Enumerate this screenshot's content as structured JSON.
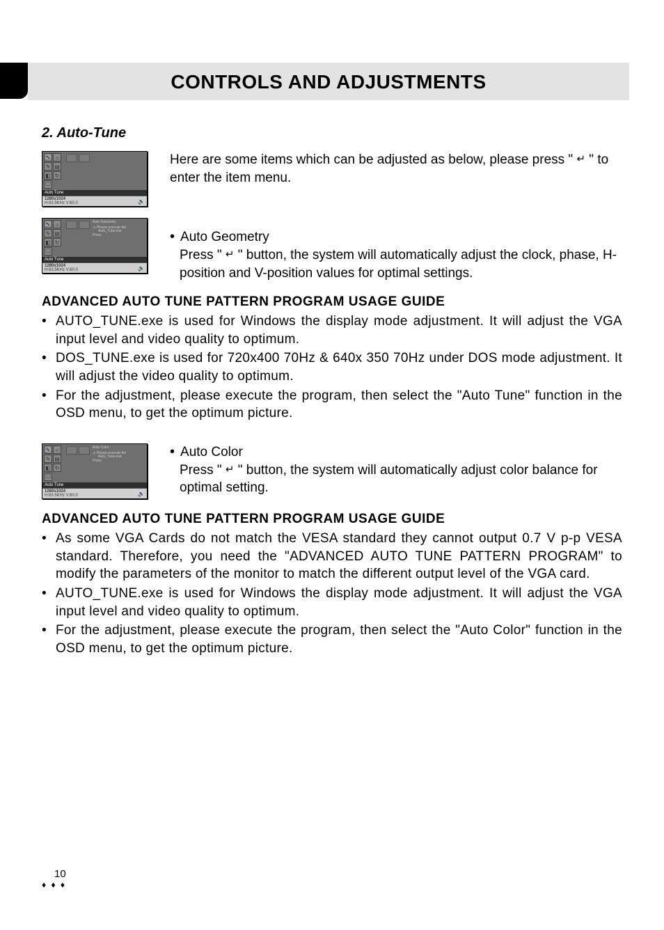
{
  "title": "CONTROLS AND ADJUSTMENTS",
  "section_number_title": "2. Auto-Tune",
  "intro_text_1": "Here are some items which can be adjusted as below, please press \" ",
  "intro_text_2": " \" to enter the item menu.",
  "enter_symbol": "↵",
  "osd_common": {
    "label": "Auto Tune",
    "res": "1280x1024",
    "freq": "H:63.5KHz V:60.0"
  },
  "osd2": {
    "sub_title": "Auto Geometry",
    "hint1": "Please execute the",
    "hint2": "Auto_Tune.exe",
    "hint3": "Press"
  },
  "osd3": {
    "sub_title": "Auto Color",
    "hint1": "Please execute the",
    "hint2": "Auto_Tune.exe",
    "hint3": "Press"
  },
  "auto_geometry": {
    "title": "Auto Geometry",
    "line1a": "Press \" ",
    "line1b": " \" button, the system will automatically adjust the clock, phase, H-position and V-position values for optimal settings."
  },
  "guide1": {
    "heading": "ADVANCED AUTO TUNE PATTERN PROGRAM USAGE GUIDE",
    "b1": "AUTO_TUNE.exe is used for Windows the display mode adjustment. It will adjust the VGA input level and video quality to optimum.",
    "b2": "DOS_TUNE.exe is used for 720x400 70Hz & 640x 350 70Hz under DOS mode adjustment. It will adjust the video quality to optimum.",
    "b3": "For the adjustment, please execute the program, then select the \"Auto Tune\" function in the OSD menu, to get the optimum picture."
  },
  "auto_color": {
    "title": "Auto Color",
    "line1a": "Press \" ",
    "line1b": " \" button, the system will automatically adjust color balance for optimal setting."
  },
  "guide2": {
    "heading": "ADVANCED AUTO TUNE PATTERN PROGRAM USAGE GUIDE",
    "b1": "As some VGA Cards do not match the VESA standard they cannot output 0.7 V p-p VESA standard. Therefore, you need the \"ADVANCED AUTO TUNE PATTERN PROGRAM\" to modify the parameters of the monitor to match the different output level of the VGA card.",
    "b2": "AUTO_TUNE.exe is used for Windows the display mode adjustment. It will adjust the VGA input level and video quality to optimum.",
    "b3": "For the adjustment, please execute the program, then select the \"Auto Color\" function in the OSD menu, to get the optimum picture."
  },
  "footer": {
    "page": "10",
    "diamonds": "♦ ♦ ♦"
  }
}
